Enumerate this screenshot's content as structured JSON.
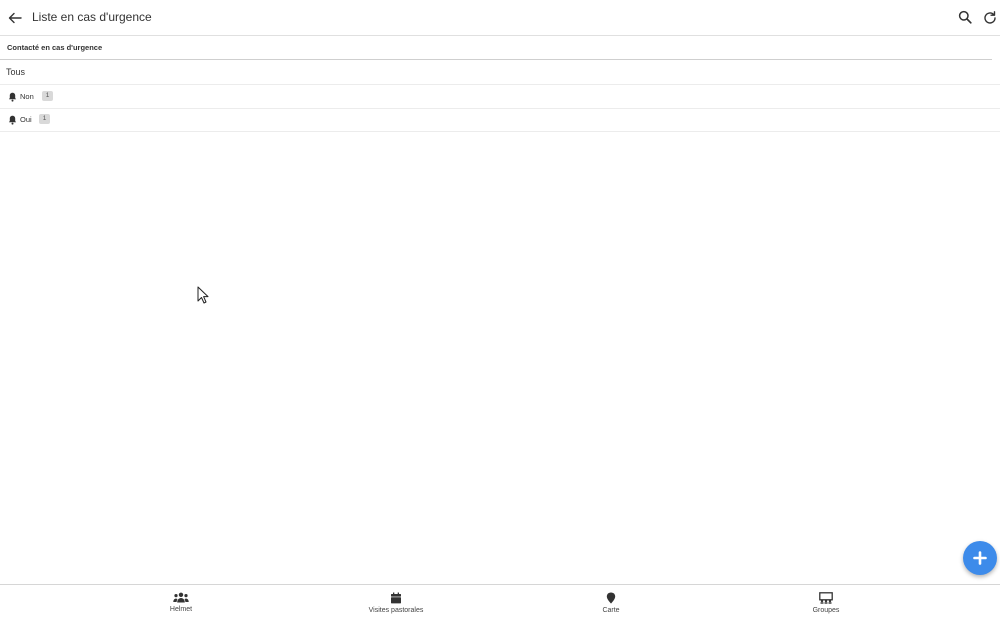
{
  "header": {
    "title": "Liste en cas d'urgence",
    "back_icon": "arrow-left-icon",
    "search_icon": "search-icon",
    "refresh_icon": "refresh-icon"
  },
  "filter": {
    "group_title": "Contacté en cas d'urgence",
    "all_label": "Tous",
    "options": [
      {
        "label": "Non",
        "count": "1",
        "icon": "bell-icon"
      },
      {
        "label": "Oui",
        "count": "1",
        "icon": "bell-icon"
      }
    ]
  },
  "fab": {
    "icon": "plus-icon",
    "color": "#3d8bea"
  },
  "bottom_nav": [
    {
      "label": "Helmet",
      "icon": "people-icon"
    },
    {
      "label": "Visites pastorales",
      "icon": "calendar-icon"
    },
    {
      "label": "Carte",
      "icon": "map-pin-icon"
    },
    {
      "label": "Groupes",
      "icon": "groups-icon"
    }
  ]
}
